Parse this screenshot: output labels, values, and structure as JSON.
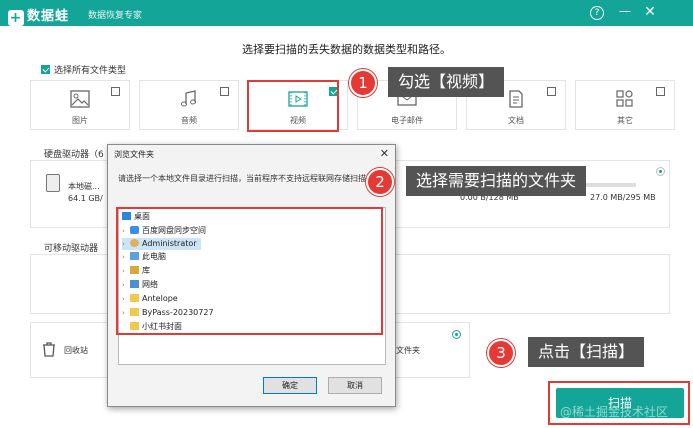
{
  "app": {
    "name": "数据蛙",
    "subtitle": "数据恢复专家"
  },
  "titlebar": {
    "help_glyph": "?",
    "min_glyph": "—",
    "close_glyph": "✕"
  },
  "heading": "选择要扫描的丢失数据的数据类型和路径。",
  "select_all": "选择所有文件类型",
  "file_types": [
    {
      "label": "图片",
      "icon": "image-icon",
      "checked": false
    },
    {
      "label": "音频",
      "icon": "music-icon",
      "checked": false
    },
    {
      "label": "视频",
      "icon": "video-icon",
      "checked": true
    },
    {
      "label": "电子邮件",
      "icon": "email-icon",
      "checked": false
    },
    {
      "label": "文档",
      "icon": "document-icon",
      "checked": false
    },
    {
      "label": "其它",
      "icon": "other-icon",
      "checked": false
    }
  ],
  "sections": {
    "hard_drives": "硬盘驱动器（6",
    "removable": "可移动驱动器"
  },
  "drives": {
    "local_name": "本地磁...",
    "local_size": "64.1 GB/",
    "mid_size": "0.00 B/128 MB",
    "right_size": "27.0 MB/295 MB"
  },
  "locations": {
    "recycle_bin": "回收站",
    "folder_tail": "文件夹"
  },
  "scan_button": "扫描",
  "watermark": "@稀土掘金技术社区",
  "callouts": [
    {
      "num": "1",
      "text": "勾选【视频】"
    },
    {
      "num": "2",
      "text": "选择需要扫描的文件夹"
    },
    {
      "num": "3",
      "text": "点击【扫描】"
    }
  ],
  "dialog": {
    "title": "浏览文件夹",
    "close": "✕",
    "description": "请选择一个本地文件目录进行扫描，当前程序不支持远程联网存储扫描恢复",
    "tree": [
      {
        "label": "桌面",
        "icon": "desktop-icon",
        "level": 0,
        "arrow": ""
      },
      {
        "label": "百度网盘同步空间",
        "icon": "cloud-folder-icon",
        "level": 1,
        "arrow": "›"
      },
      {
        "label": "Administrator",
        "icon": "user-icon",
        "level": 1,
        "arrow": "›"
      },
      {
        "label": "此电脑",
        "icon": "computer-icon",
        "level": 1,
        "arrow": "›"
      },
      {
        "label": "库",
        "icon": "library-icon",
        "level": 1,
        "arrow": "›"
      },
      {
        "label": "网络",
        "icon": "network-icon",
        "level": 1,
        "arrow": "›"
      },
      {
        "label": "Antelope",
        "icon": "folder-icon",
        "level": 1,
        "arrow": "›"
      },
      {
        "label": "ByPass-20230727",
        "icon": "folder-icon",
        "level": 1,
        "arrow": "›"
      },
      {
        "label": "小红书封面",
        "icon": "folder-icon",
        "level": 1,
        "arrow": ""
      }
    ],
    "ok": "确定",
    "cancel": "取消"
  },
  "colors": {
    "brand": "#13a597",
    "highlight": "#e53935",
    "callout_bg": "#545454"
  }
}
